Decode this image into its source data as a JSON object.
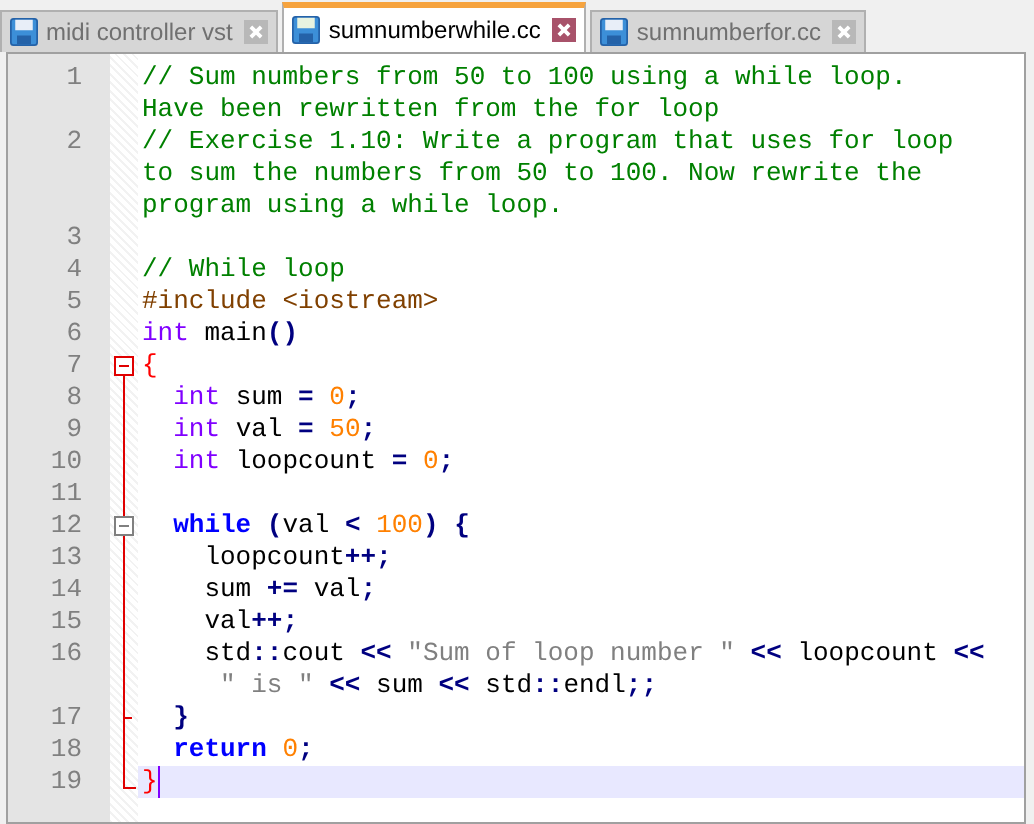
{
  "tabs": [
    {
      "label": "midi controller vst",
      "selected": false
    },
    {
      "label": "sumnumberwhile.cc",
      "selected": true
    },
    {
      "label": "sumnumberfor.cc",
      "selected": false
    }
  ],
  "lines": [
    {
      "number": "1",
      "kind": "plain",
      "rows": [
        {
          "tokens": [
            {
              "t": "// Sum numbers from 50 to 100 using a while loop.",
              "kind": "comment"
            }
          ]
        },
        {
          "tokens": [
            {
              "t": "Have been rewritten from the for loop",
              "kind": "comment"
            }
          ]
        }
      ]
    },
    {
      "number": "2",
      "kind": "plain",
      "rows": [
        {
          "tokens": [
            {
              "t": "// Exercise 1.10: Write a program that uses for loop",
              "kind": "comment"
            }
          ]
        },
        {
          "tokens": [
            {
              "t": "to sum the numbers from 50 to 100. Now rewrite the",
              "kind": "comment"
            }
          ]
        },
        {
          "tokens": [
            {
              "t": "program using a while loop.",
              "kind": "comment"
            }
          ]
        }
      ]
    },
    {
      "number": "3",
      "kind": "plain"
    },
    {
      "number": "4",
      "kind": "plain",
      "rows": [
        {
          "tokens": [
            {
              "t": "// While loop",
              "kind": "comment"
            }
          ]
        }
      ]
    },
    {
      "number": "5",
      "kind": "plain",
      "rows": [
        {
          "tokens": [
            {
              "t": "#include <iostream>",
              "kind": "preproc"
            }
          ]
        }
      ]
    },
    {
      "number": "6",
      "kind": "plain",
      "rows": [
        {
          "tokens": [
            {
              "t": "int",
              "kind": "type"
            },
            {
              "t": " main",
              "kind": "plain"
            },
            {
              "t": "()",
              "kind": "op"
            }
          ]
        }
      ]
    },
    {
      "number": "7",
      "kind": "fold_start",
      "rows": [
        {
          "tokens": [
            {
              "t": "{",
              "kind": "match"
            }
          ]
        }
      ]
    },
    {
      "number": "8",
      "kind": "fold_body",
      "rows": [
        {
          "tokens": [
            {
              "t": "  int",
              "kind": "type"
            },
            {
              "t": " sum ",
              "kind": "plain"
            },
            {
              "t": "= ",
              "kind": "op"
            },
            {
              "t": "0",
              "kind": "number"
            },
            {
              "t": ";",
              "kind": "op"
            }
          ]
        }
      ]
    },
    {
      "number": "9",
      "kind": "fold_body",
      "rows": [
        {
          "tokens": [
            {
              "t": "  int",
              "kind": "type"
            },
            {
              "t": " val ",
              "kind": "plain"
            },
            {
              "t": "= ",
              "kind": "op"
            },
            {
              "t": "50",
              "kind": "number"
            },
            {
              "t": ";",
              "kind": "op"
            }
          ]
        }
      ]
    },
    {
      "number": "10",
      "kind": "fold_body",
      "rows": [
        {
          "tokens": [
            {
              "t": "  int",
              "kind": "type"
            },
            {
              "t": " loopcount ",
              "kind": "plain"
            },
            {
              "t": "= ",
              "kind": "op"
            },
            {
              "t": "0",
              "kind": "number"
            },
            {
              "t": ";",
              "kind": "op"
            }
          ]
        }
      ]
    },
    {
      "number": "11",
      "kind": "fold_body"
    },
    {
      "number": "12",
      "kind": "fold_inner_start",
      "rows": [
        {
          "tokens": [
            {
              "t": "  while ",
              "kind": "keyword"
            },
            {
              "t": "(",
              "kind": "op"
            },
            {
              "t": "val ",
              "kind": "plain"
            },
            {
              "t": "< ",
              "kind": "op"
            },
            {
              "t": "100",
              "kind": "number"
            },
            {
              "t": ") {",
              "kind": "op"
            }
          ]
        }
      ]
    },
    {
      "number": "13",
      "kind": "fold_body",
      "rows": [
        {
          "tokens": [
            {
              "t": "    loopcount",
              "kind": "plain"
            },
            {
              "t": "++;",
              "kind": "op"
            }
          ]
        }
      ]
    },
    {
      "number": "14",
      "kind": "fold_body",
      "rows": [
        {
          "tokens": [
            {
              "t": "    sum ",
              "kind": "plain"
            },
            {
              "t": "+=",
              "kind": "op"
            },
            {
              "t": " val",
              "kind": "plain"
            },
            {
              "t": ";",
              "kind": "op"
            }
          ]
        }
      ]
    },
    {
      "number": "15",
      "kind": "fold_body",
      "rows": [
        {
          "tokens": [
            {
              "t": "    val",
              "kind": "plain"
            },
            {
              "t": "++;",
              "kind": "op"
            }
          ]
        }
      ]
    },
    {
      "number": "16",
      "kind": "fold_body",
      "rows": [
        {
          "tokens": [
            {
              "t": "    std",
              "kind": "plain"
            },
            {
              "t": "::",
              "kind": "op"
            },
            {
              "t": "cout ",
              "kind": "plain"
            },
            {
              "t": "<< ",
              "kind": "op"
            },
            {
              "t": "\"Sum of loop number \" ",
              "kind": "string"
            },
            {
              "t": "<<",
              "kind": "op"
            },
            {
              "t": " loopcount ",
              "kind": "plain"
            },
            {
              "t": "<<",
              "kind": "op"
            }
          ]
        },
        {
          "tokens": [
            {
              "t": "     \" is \" ",
              "kind": "string"
            },
            {
              "t": "<<",
              "kind": "op"
            },
            {
              "t": " sum ",
              "kind": "plain"
            },
            {
              "t": "<<",
              "kind": "op"
            },
            {
              "t": " std",
              "kind": "plain"
            },
            {
              "t": "::",
              "kind": "op"
            },
            {
              "t": "endl",
              "kind": "plain"
            },
            {
              "t": ";;",
              "kind": "op"
            }
          ]
        }
      ]
    },
    {
      "number": "17",
      "kind": "fold_inner_end",
      "rows": [
        {
          "tokens": [
            {
              "t": "  }",
              "kind": "op"
            }
          ]
        }
      ]
    },
    {
      "number": "18",
      "kind": "fold_body",
      "rows": [
        {
          "tokens": [
            {
              "t": "  return ",
              "kind": "keyword"
            },
            {
              "t": "0",
              "kind": "number"
            },
            {
              "t": ";",
              "kind": "op"
            }
          ]
        }
      ]
    },
    {
      "number": "19",
      "kind": "fold_end",
      "current": true,
      "rows": [
        {
          "tokens": [
            {
              "t": "}",
              "kind": "match"
            }
          ]
        }
      ]
    }
  ]
}
